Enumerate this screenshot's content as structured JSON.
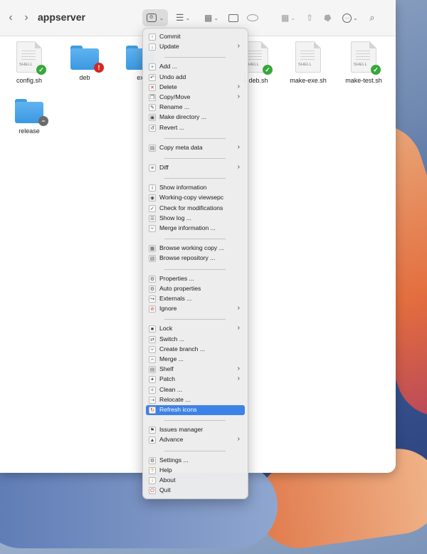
{
  "window": {
    "title": "appserver",
    "toolbar": {
      "back_icon": "chevron-left-icon",
      "forward_icon": "chevron-right-icon",
      "view_options_icon": "list-icon",
      "group_icon": "grid-icon",
      "new_folder_icon": "folder-badge-icon",
      "preview_icon": "eye-icon",
      "share_icon": "share-icon",
      "tag_icon": "tag-icon",
      "more_icon": "ellipsis-circle-icon",
      "search_icon": "magnifier-icon",
      "plugin_icon": "svn-plugin-icon"
    }
  },
  "files": [
    {
      "name": "config.sh",
      "kind": "script",
      "tag": "SHELL",
      "status": "ok"
    },
    {
      "name": "deb",
      "kind": "folder",
      "status": "error"
    },
    {
      "name": "ex",
      "kind": "folder",
      "status": "none"
    },
    {
      "name": "e-deb.sh",
      "kind": "script",
      "tag": "SHELL",
      "status": "ok"
    },
    {
      "name": "make-exe.sh",
      "kind": "script",
      "tag": "SHELL",
      "status": "none"
    },
    {
      "name": "make-test.sh",
      "kind": "script",
      "tag": "SHELL",
      "status": "ok"
    },
    {
      "name": "release",
      "kind": "folder",
      "status": "ignored"
    }
  ],
  "menu": {
    "groups": [
      [
        {
          "label": "Commit",
          "icon": "arrow-up-icon",
          "submenu": false
        },
        {
          "label": "Update",
          "icon": "arrow-down-icon",
          "submenu": true
        }
      ],
      [
        {
          "label": "Add ...",
          "icon": "plus-icon",
          "submenu": false
        },
        {
          "label": "Undo add",
          "icon": "undo-icon",
          "submenu": false
        },
        {
          "label": "Delete",
          "icon": "x-icon",
          "submenu": true
        },
        {
          "label": "Copy/Move",
          "icon": "copy-icon",
          "submenu": true
        },
        {
          "label": "Rename ...",
          "icon": "pencil-icon",
          "submenu": false
        },
        {
          "label": "Make directory ...",
          "icon": "folder-plus-icon",
          "submenu": false
        },
        {
          "label": "Revert ...",
          "icon": "revert-icon",
          "submenu": false
        }
      ],
      [
        {
          "label": "Copy meta data",
          "icon": "briefcase-icon",
          "submenu": true
        }
      ],
      [
        {
          "label": "Diff",
          "icon": "diff-icon",
          "submenu": true
        }
      ],
      [
        {
          "label": "Show information",
          "icon": "info-icon",
          "submenu": false
        },
        {
          "label": "Working-copy viewsepc",
          "icon": "eye-icon",
          "submenu": false
        },
        {
          "label": "Check for modifications",
          "icon": "check-icon",
          "submenu": false
        },
        {
          "label": "Show log ...",
          "icon": "log-icon",
          "submenu": false
        },
        {
          "label": "Merge information ...",
          "icon": "merge-info-icon",
          "submenu": false
        }
      ],
      [
        {
          "label": "Browse working copy ...",
          "icon": "browse-icon",
          "submenu": false
        },
        {
          "label": "Browse repository ...",
          "icon": "repository-icon",
          "submenu": false
        }
      ],
      [
        {
          "label": "Properties ...",
          "icon": "properties-icon",
          "submenu": false
        },
        {
          "label": "Auto properties",
          "icon": "auto-properties-icon",
          "submenu": false
        },
        {
          "label": "Externals ...",
          "icon": "externals-icon",
          "submenu": false
        },
        {
          "label": "Ignore",
          "icon": "ignore-icon",
          "submenu": true
        }
      ],
      [
        {
          "label": "Lock",
          "icon": "lock-icon",
          "submenu": true
        },
        {
          "label": "Switch ...",
          "icon": "switch-icon",
          "submenu": false
        },
        {
          "label": "Create branch ...",
          "icon": "branch-icon",
          "submenu": false
        },
        {
          "label": "Merge ...",
          "icon": "merge-icon",
          "submenu": false
        },
        {
          "label": "Shelf",
          "icon": "shelf-icon",
          "submenu": true
        },
        {
          "label": "Patch",
          "icon": "patch-icon",
          "submenu": true
        },
        {
          "label": "Clean ...",
          "icon": "clean-icon",
          "submenu": false
        },
        {
          "label": "Relocate ...",
          "icon": "relocate-icon",
          "submenu": false
        },
        {
          "label": "Refresh icons",
          "icon": "refresh-icon",
          "submenu": false,
          "highlighted": true
        }
      ],
      [
        {
          "label": "Issues manager",
          "icon": "issues-icon",
          "submenu": false
        },
        {
          "label": "Advance",
          "icon": "advance-icon",
          "submenu": true
        }
      ],
      [
        {
          "label": "Settings ...",
          "icon": "settings-icon",
          "submenu": false
        },
        {
          "label": "Help",
          "icon": "help-icon",
          "submenu": false
        },
        {
          "label": "About",
          "icon": "about-icon",
          "submenu": false
        },
        {
          "label": "Quit",
          "icon": "quit-icon",
          "submenu": false
        }
      ]
    ]
  },
  "colors": {
    "highlight": "#3d82e6",
    "folder": "#4aa6ec",
    "status_ok": "#37a83a",
    "status_error": "#d22a22"
  }
}
